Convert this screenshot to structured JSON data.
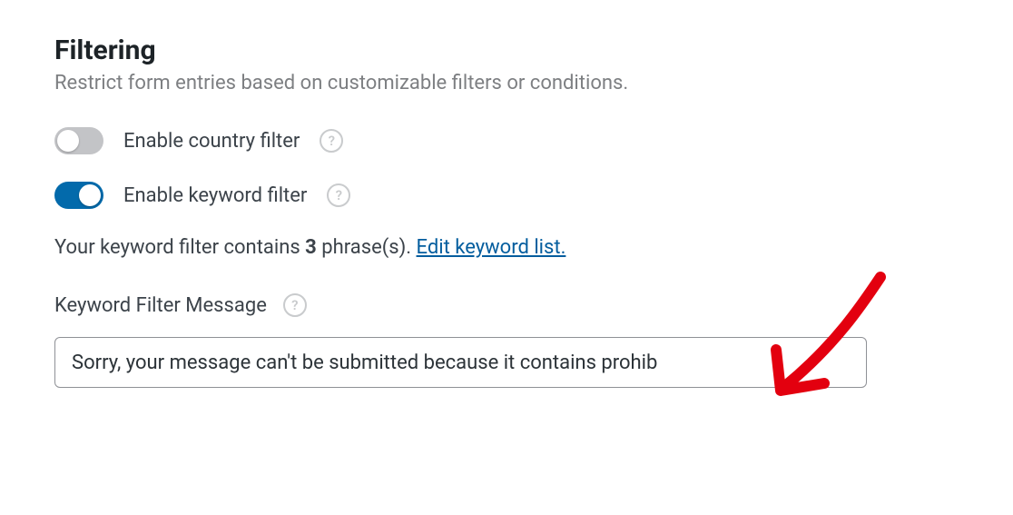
{
  "section": {
    "title": "Filtering",
    "description": "Restrict form entries based on customizable filters or conditions."
  },
  "toggles": {
    "country": {
      "label": "Enable country filter",
      "enabled": false
    },
    "keyword": {
      "label": "Enable keyword filter",
      "enabled": true
    }
  },
  "keyword_info": {
    "prefix": "Your keyword filter contains ",
    "count": "3",
    "suffix": " phrase(s). ",
    "edit_link": "Edit keyword list."
  },
  "message_field": {
    "label": "Keyword Filter Message",
    "value": "Sorry, your message can't be submitted because it contains prohib"
  },
  "help_glyph": "?"
}
